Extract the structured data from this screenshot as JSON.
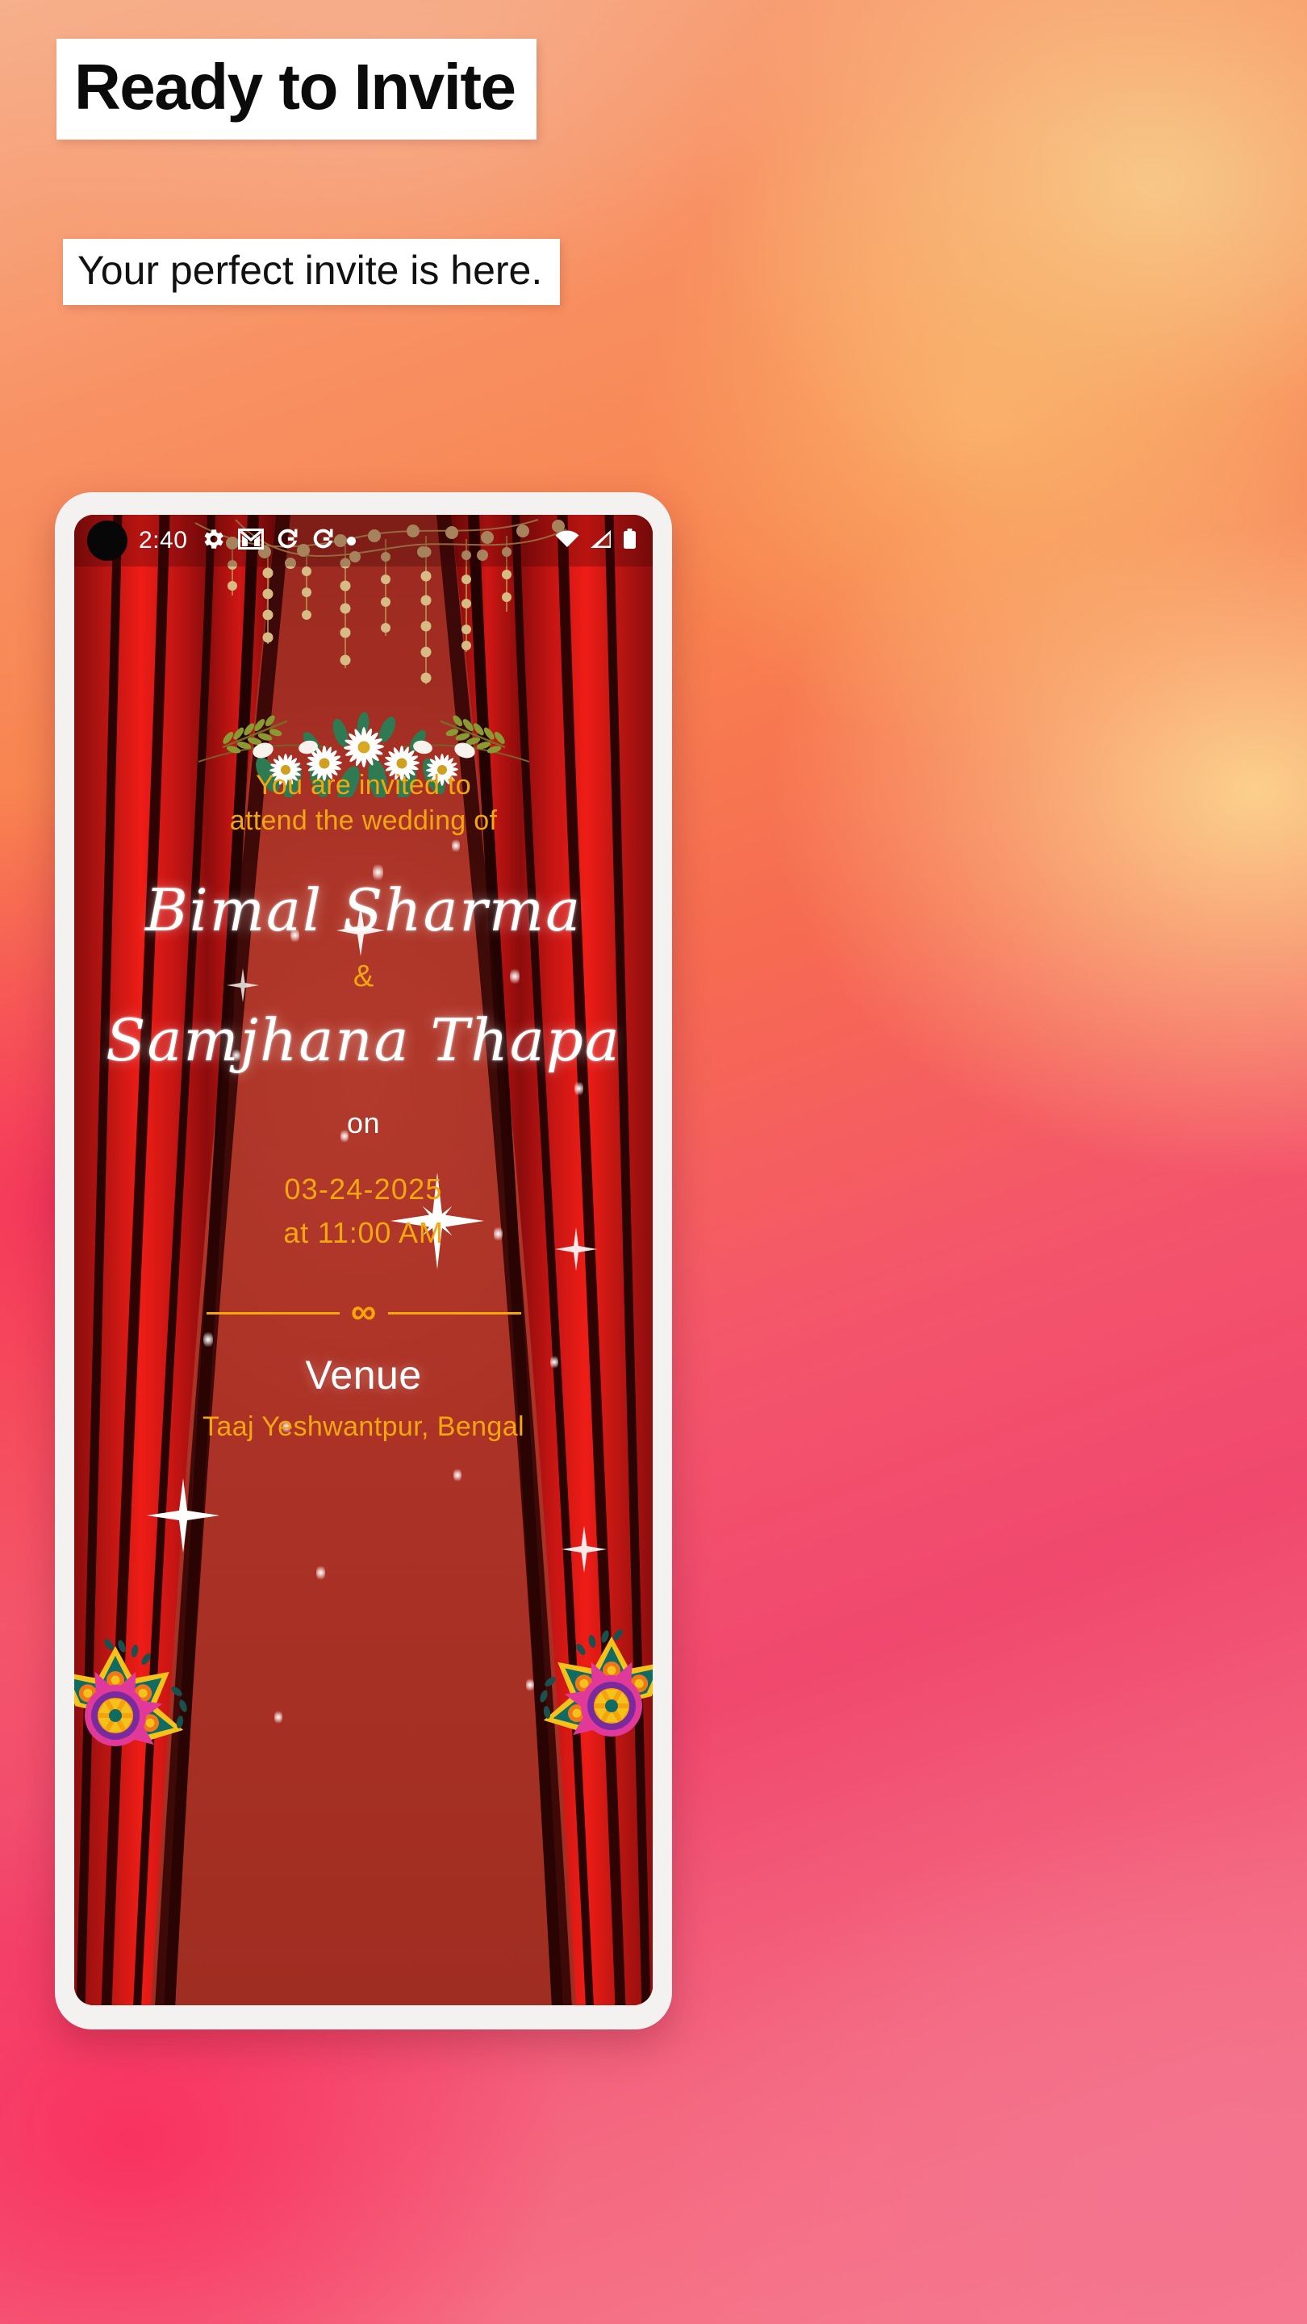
{
  "promo": {
    "headline": "Ready to Invite",
    "subheading": "Your perfect invite is here."
  },
  "statusbar": {
    "time": "2:40",
    "icons_left": [
      "gear-icon",
      "gmail-icon",
      "google-g-icon",
      "google-g-icon",
      "dot-icon"
    ],
    "icons_right": [
      "wifi-icon",
      "cellular-signal-icon",
      "battery-icon"
    ]
  },
  "invite": {
    "lead_line_1": "You are invited to",
    "lead_line_2": "attend the wedding of",
    "bride_or_groom_1": "Bimal  Sharma",
    "ampersand": "&",
    "bride_or_groom_2": "Samjhana  Thapa",
    "on_word": "on",
    "date": "03-24-2025",
    "time": "at 11:00 AM",
    "divider_symbol": "∞",
    "venue_title": "Venue",
    "venue_text": "Taaj Yeshwantpur, Bengal"
  },
  "colors": {
    "gold": "#f2a711",
    "stage_red": "#a32d22",
    "curtain_red": "#d41714",
    "white": "#ffffff",
    "bg_orange": "#f8834f",
    "bg_pink": "#f4556b"
  }
}
